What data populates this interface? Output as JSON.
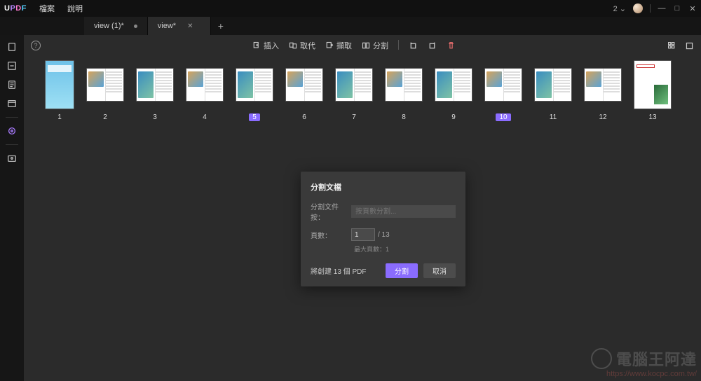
{
  "app": {
    "logo_u": "U",
    "logo_p": "P",
    "logo_d": "D",
    "logo_f": "F"
  },
  "menus": {
    "file": "檔案",
    "help": "說明"
  },
  "tabs": {
    "items": [
      {
        "label": "view (1)*",
        "active": false
      },
      {
        "label": "view*",
        "active": true
      }
    ],
    "add": "+"
  },
  "titlebar": {
    "counter": "2",
    "chevron": "⌄",
    "minimize": "—",
    "maximize": "□",
    "close": "✕"
  },
  "toolbar": {
    "help": "?",
    "insert": "插入",
    "replace": "取代",
    "extract": "擷取",
    "split": "分割"
  },
  "thumbnails": {
    "count": 13,
    "labels": [
      "1",
      "2",
      "3",
      "4",
      "5",
      "6",
      "7",
      "8",
      "9",
      "10",
      "11",
      "12",
      "13"
    ],
    "selected": [
      5,
      10
    ]
  },
  "dialog": {
    "title": "分割文檔",
    "split_by_label": "分割文件按：",
    "split_by_placeholder": "按頁數分割...",
    "pages_label": "頁數：",
    "pages_value": "1",
    "pages_total": "/ 13",
    "max_hint": "最大頁數：1",
    "result_info": "將創建 13 個 PDF",
    "ok": "分割",
    "cancel": "取消"
  },
  "watermark": {
    "text": "電腦王阿達",
    "url": "https://www.kocpc.com.tw/"
  }
}
